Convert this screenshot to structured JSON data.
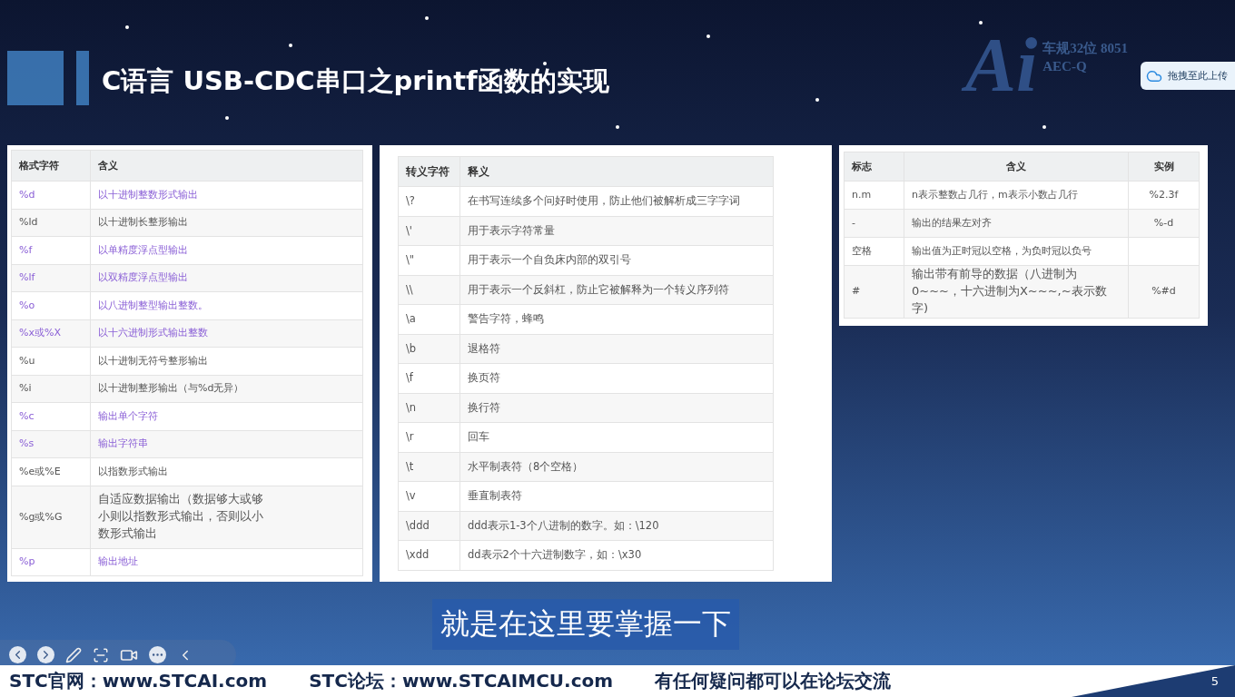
{
  "slide": {
    "title": "C语言 USB-CDC串口之printf函数的实现",
    "logo": {
      "mark": "Ai",
      "line_1": "车规32位 8051",
      "line_2": "AEC-Q"
    },
    "page_number": "5"
  },
  "upload_button": {
    "label": "拖拽至此上传"
  },
  "format_table": {
    "columns": [
      "格式字符",
      "含义"
    ],
    "rows": [
      {
        "cells": [
          "%d",
          "以十进制整数形式输出"
        ],
        "highlighted": true
      },
      {
        "cells": [
          "%ld",
          "以十进制长整形输出"
        ],
        "highlighted": false
      },
      {
        "cells": [
          "%f",
          "以单精度浮点型输出"
        ],
        "highlighted": true
      },
      {
        "cells": [
          "%lf",
          "以双精度浮点型输出"
        ],
        "highlighted": true
      },
      {
        "cells": [
          "%o",
          "以八进制整型输出整数。"
        ],
        "highlighted": true
      },
      {
        "cells": [
          "%x或%X",
          "以十六进制形式输出整数"
        ],
        "highlighted": true
      },
      {
        "cells": [
          "%u",
          "以十进制无符号整形输出"
        ],
        "highlighted": false
      },
      {
        "cells": [
          "%i",
          "以十进制整形输出（与%d无异）"
        ],
        "highlighted": false
      },
      {
        "cells": [
          "%c",
          "输出单个字符"
        ],
        "highlighted": true
      },
      {
        "cells": [
          "%s",
          "输出字符串"
        ],
        "highlighted": true
      },
      {
        "cells": [
          "%e或%E",
          "以指数形式输出"
        ],
        "highlighted": false
      },
      {
        "cells": [
          "%g或%G",
          "自适应数据输出（数据够大或够小则以指数形式输出，否则以小数形式输出"
        ],
        "highlighted": false
      },
      {
        "cells": [
          "%p",
          "输出地址"
        ],
        "highlighted": true
      }
    ]
  },
  "escape_table": {
    "columns": [
      "转义字符",
      "释义"
    ],
    "rows": [
      [
        "\\?",
        "在书写连续多个问好时使用，防止他们被解析成三字字词"
      ],
      [
        "\\'",
        "用于表示字符常量"
      ],
      [
        "\\\"",
        "用于表示一个自负床内部的双引号"
      ],
      [
        "\\\\",
        "用于表示一个反斜杠，防止它被解释为一个转义序列符"
      ],
      [
        "\\a",
        "警告字符，蜂鸣"
      ],
      [
        "\\b",
        "退格符"
      ],
      [
        "\\f",
        "换页符"
      ],
      [
        "\\n",
        "换行符"
      ],
      [
        "\\r",
        "回车"
      ],
      [
        "\\t",
        "水平制表符（8个空格）"
      ],
      [
        "\\v",
        "垂直制表符"
      ],
      [
        "\\ddd",
        "ddd表示1-3个八进制的数字。如：\\120"
      ],
      [
        "\\xdd",
        "dd表示2个十六进制数字，如：\\x30"
      ]
    ]
  },
  "flag_table": {
    "columns": [
      "标志",
      "含义",
      "实例"
    ],
    "rows": [
      [
        "n.m",
        "n表示整数占几行，m表示小数占几行",
        "%2.3f"
      ],
      [
        "-",
        "输出的结果左对齐",
        "%-d"
      ],
      [
        "空格",
        "输出值为正时冠以空格，为负时冠以负号",
        ""
      ],
      [
        "#",
        "输出带有前导的数据（八进制为0~~~，十六进制为X~~~,~表示数字)",
        "%#d"
      ]
    ]
  },
  "subtitle": "就是在这里要掌握一下",
  "footer": [
    "STC官网：www.STCAI.com",
    "STC论坛：www.STCAIMCU.com",
    "有任何疑问都可以在论坛交流"
  ]
}
